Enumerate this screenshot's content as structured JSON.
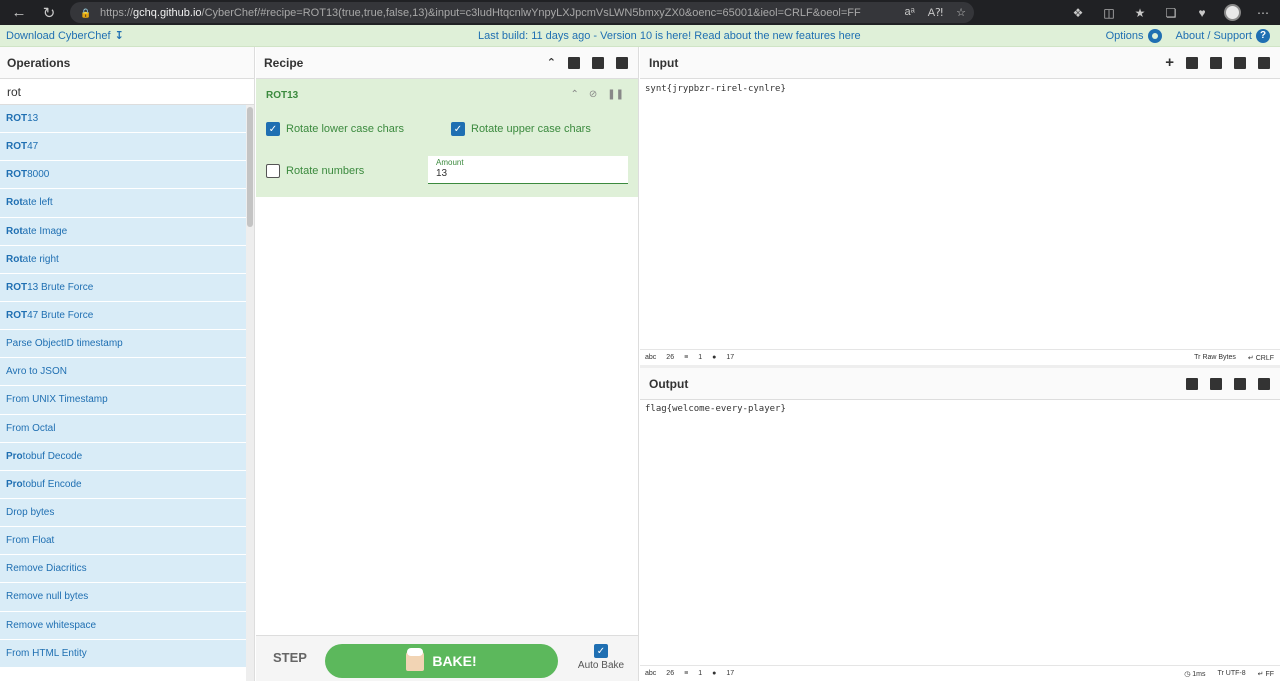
{
  "browser": {
    "url_prefix": "https://",
    "url_host": "gchq.github.io",
    "url_rest": "/CyberChef/#recipe=ROT13(true,true,false,13)&input=c3ludHtqcnlwYnpyLXJpcmVsLWN5bmxyZX0&oenc=65001&ieol=CRLF&oeol=FF"
  },
  "banner": {
    "download": "Download CyberChef",
    "notice": "Last build: 11 days ago - Version 10 is here! Read about the new features here",
    "options": "Options",
    "about": "About / Support"
  },
  "operations": {
    "title": "Operations",
    "search": "rot",
    "items": [
      {
        "bold": "ROT",
        "rest": "13"
      },
      {
        "bold": "ROT",
        "rest": "47"
      },
      {
        "bold": "ROT",
        "rest": "8000"
      },
      {
        "bold": "Rot",
        "rest": "ate left"
      },
      {
        "bold": "Rot",
        "rest": "ate Image"
      },
      {
        "bold": "Rot",
        "rest": "ate right"
      },
      {
        "bold": "ROT",
        "rest": "13 Brute Force"
      },
      {
        "bold": "ROT",
        "rest": "47 Brute Force"
      },
      {
        "bold": "",
        "rest": "Parse ObjectID timestamp"
      },
      {
        "bold": "",
        "rest": "Avro to JSON"
      },
      {
        "bold": "",
        "rest": "From UNIX Timestamp"
      },
      {
        "bold": "",
        "rest": "From Octal"
      },
      {
        "bold": "Pro",
        "rest": "tobuf Decode"
      },
      {
        "bold": "Pro",
        "rest": "tobuf Encode"
      },
      {
        "bold": "",
        "rest": "Drop bytes"
      },
      {
        "bold": "",
        "rest": "From Float"
      },
      {
        "bold": "",
        "rest": "Remove Diacritics"
      },
      {
        "bold": "",
        "rest": "Remove null bytes"
      },
      {
        "bold": "",
        "rest": "Remove whitespace"
      },
      {
        "bold": "",
        "rest": "From HTML Entity"
      }
    ]
  },
  "recipe": {
    "title": "Recipe",
    "op_name": "ROT13",
    "rotate_lower_label": "Rotate lower case chars",
    "rotate_upper_label": "Rotate upper case chars",
    "rotate_numbers_label": "Rotate numbers",
    "rotate_lower": true,
    "rotate_upper": true,
    "rotate_numbers": false,
    "amount_label": "Amount",
    "amount_value": "13",
    "step_label": "STEP",
    "bake_label": "BAKE!",
    "autobake_label": "Auto Bake"
  },
  "input": {
    "title": "Input",
    "text": "synt{jrypbzr-rirel-cynlre}",
    "status_length": "26",
    "status_lines": "1",
    "status_pos": "17",
    "raw_bytes": "Raw Bytes",
    "eol": "CRLF"
  },
  "output": {
    "title": "Output",
    "text": "flag{welcome-every-player}",
    "status_length": "26",
    "status_lines": "1",
    "status_pos": "17",
    "time": "1ms",
    "encoding": "UTF-8",
    "eol": "FF"
  }
}
